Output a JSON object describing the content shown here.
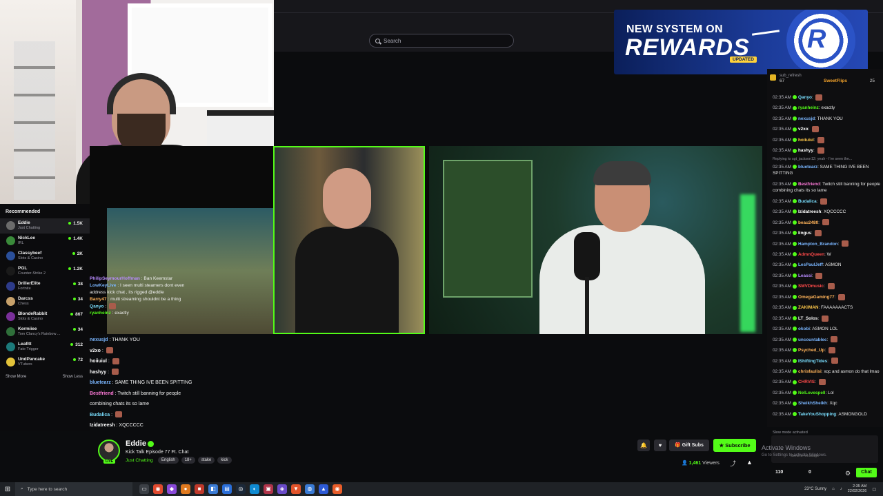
{
  "header": {
    "search_placeholder": "Search"
  },
  "rewards_banner": {
    "line1": "NEW SYSTEM ON",
    "line2": "REWARDS",
    "badge": "UPDATED",
    "chip_letter": "R"
  },
  "recommended": {
    "title": "Recommended",
    "items": [
      {
        "name": "Eddie",
        "category": "Just Chatting",
        "viewers": "1.5K",
        "color": "#6b6b6b"
      },
      {
        "name": "NickLee",
        "category": "IRL",
        "viewers": "1.4K",
        "color": "#3a8a3a"
      },
      {
        "name": "Classybeef",
        "category": "Slots & Casino",
        "viewers": "2K",
        "color": "#2a4f9a"
      },
      {
        "name": "PGL",
        "category": "Counter-Strike 2",
        "viewers": "1.2K",
        "color": "#1a1a1a"
      },
      {
        "name": "DrillerElite",
        "category": "Fortnite",
        "viewers": "38",
        "color": "#2d3b8a"
      },
      {
        "name": "Darcss",
        "category": "Chess",
        "viewers": "34",
        "color": "#c7a16b"
      },
      {
        "name": "BlondeRabbit",
        "category": "Slots & Casino",
        "viewers": "867",
        "color": "#7a2f9a"
      },
      {
        "name": "Kermiiee",
        "category": "Tom Clancy's Rainbow ...",
        "viewers": "34",
        "color": "#2f6f3a"
      },
      {
        "name": "Leafitt",
        "category": "Fate Trigger",
        "viewers": "312",
        "color": "#1c7a7a"
      },
      {
        "name": "UndPancake",
        "category": "VTubers",
        "viewers": "72",
        "color": "#e3c33a"
      }
    ],
    "show_more": "Show More",
    "show_less": "Show Less"
  },
  "overlay_chat_top": [
    {
      "user": "PhilipSeymourHoffman",
      "text": "Ban Keemstar",
      "color": "#b98cff"
    },
    {
      "user": "LowKeyLive",
      "text": "I seen multi steamers dont even",
      "color": "#7ab6ff"
    },
    {
      "user": "",
      "text": "address kick chat , its rigged @eddie",
      "color": "#ffffff"
    },
    {
      "user": "Barry47",
      "text": "multi streaming shouldnt be a thing",
      "color": "#ffb35a"
    },
    {
      "user": "Qanyo",
      "text": "",
      "color": "#7adfff"
    },
    {
      "user": "ryanheinz",
      "text": "exactly",
      "color": "#53fc18"
    }
  ],
  "overlay_chat_bottom": [
    {
      "user": "nexusjd",
      "text": "THANK YOU",
      "color": "#7ab6ff"
    },
    {
      "user": "v2xo",
      "text": "",
      "color": "#ffffff"
    },
    {
      "user": "hoiiuiul",
      "text": "",
      "color": "#ffffff"
    },
    {
      "user": "hashyy",
      "text": "",
      "color": "#ffffff"
    },
    {
      "user": "bluetearz",
      "text": "SAME THING IVE BEEN SPITTING",
      "color": "#7ab6ff"
    },
    {
      "user": "Bestfriend",
      "text": "Twitch still banning for people",
      "color": "#ff7ad9"
    },
    {
      "user": "",
      "text": "combining chats its so lame",
      "color": "#ffffff"
    },
    {
      "user": "Budalica",
      "text": "",
      "color": "#7adfff"
    },
    {
      "user": "Izidatreesh",
      "text": "XQCCCCC",
      "color": "#ffffff"
    }
  ],
  "chat_header": {
    "lead": "sub_refresh",
    "sweetflips": "SweetFlips",
    "left_count": "67",
    "right_count": "25"
  },
  "chat_messages": [
    {
      "time": "02:35 AM",
      "user": "Qanyo",
      "text": "",
      "color": "#7adfff"
    },
    {
      "time": "02:35 AM",
      "user": "ryanheinz",
      "text": "exactly",
      "color": "#53fc18"
    },
    {
      "time": "02:35 AM",
      "user": "nexusjd",
      "text": "THANK YOU",
      "color": "#7ab6ff"
    },
    {
      "time": "02:35 AM",
      "user": "v2xo",
      "text": "",
      "color": "#ffffff"
    },
    {
      "time": "02:35 AM",
      "user": "hoiiuiul",
      "text": "",
      "color": "#ffc84a"
    },
    {
      "time": "02:35 AM",
      "user": "hashyy",
      "text": "",
      "color": "#ffffff"
    },
    {
      "reply": "Replying to sgt_jackson12: yeah - I've seen the..."
    },
    {
      "time": "02:35 AM",
      "user": "bluetearz",
      "text": "SAME THING IVE BEEN SPITTING",
      "color": "#7ab6ff",
      "wrap": true
    },
    {
      "time": "02:35 AM",
      "user": "Bestfriend",
      "text": "Twitch still banning for people combining chats its so lame",
      "color": "#ff7ad9",
      "wrap": true
    },
    {
      "time": "02:35 AM",
      "user": "Budalica",
      "text": "",
      "color": "#7adfff"
    },
    {
      "time": "02:35 AM",
      "user": "Izidatreesh",
      "text": "XQCCCCC",
      "color": "#ffffff"
    },
    {
      "time": "02:35 AM",
      "user": "beau2480",
      "text": "",
      "color": "#ffb35a"
    },
    {
      "time": "02:35 AM",
      "user": "lingus",
      "text": "",
      "color": "#ffffff"
    },
    {
      "time": "02:35 AM",
      "user": "Hampton_Brandon",
      "text": "",
      "color": "#7ab6ff"
    },
    {
      "time": "02:35 AM",
      "user": "AdmnQueen",
      "text": "W",
      "color": "#ff4a4a"
    },
    {
      "time": "02:35 AM",
      "user": "LesPaulJeff",
      "text": "ASMON",
      "color": "#7ab6ff"
    },
    {
      "time": "02:35 AM",
      "user": "Leassi",
      "text": "",
      "color": "#b98cff"
    },
    {
      "time": "02:35 AM",
      "user": "SMVDmusic",
      "text": "",
      "color": "#ff4a4a"
    },
    {
      "time": "02:35 AM",
      "user": "OmegaGaming77",
      "text": "",
      "color": "#ffb35a"
    },
    {
      "time": "02:35 AM",
      "user": "ZAKIMAN",
      "text": "FAAAAAAACTS",
      "color": "#ffc84a"
    },
    {
      "time": "02:35 AM",
      "user": "LT_Solos",
      "text": "",
      "color": "#ffffff"
    },
    {
      "time": "02:35 AM",
      "user": "okobi",
      "text": "ASMON LOL",
      "color": "#7ab6ff"
    },
    {
      "time": "02:35 AM",
      "user": "uncountablec",
      "text": "",
      "color": "#7ab6ff"
    },
    {
      "time": "02:35 AM",
      "user": "Psyched_Up",
      "text": "",
      "color": "#ffb35a"
    },
    {
      "time": "02:35 AM",
      "user": "IShiftingTides",
      "text": "",
      "color": "#7adfff"
    },
    {
      "time": "02:35 AM",
      "user": "chrisfaulisi",
      "text": "xqc and asmon do that lmao",
      "color": "#ffb35a",
      "wrap": true
    },
    {
      "time": "02:35 AM",
      "user": "CHRVIS",
      "text": "",
      "color": "#ff4a4a"
    },
    {
      "time": "02:35 AM",
      "user": "NelLovespell",
      "text": "Lol",
      "color": "#53fc18"
    },
    {
      "time": "02:35 AM",
      "user": "SheikhSheikh",
      "text": "Xqc",
      "color": "#7ab6ff"
    },
    {
      "time": "02:35 AM",
      "user": "TakeYouShopping",
      "text": "ASMONGOLD",
      "color": "#7adfff"
    }
  ],
  "chat_footer": {
    "slow_mode": "Slow mode activated",
    "send_placeholder": "Send a message",
    "points": "110",
    "points2": "0",
    "chat_button": "Chat"
  },
  "windows_watermark": {
    "line1": "Activate Windows",
    "line2": "Go to Settings to activate Windows."
  },
  "stream": {
    "streamer": "Eddie",
    "live_badge": "LIVE",
    "title": "Kick Talk Episode 77 Ft. Chat",
    "category": "Just Chatting",
    "tags": [
      "English",
      "18+",
      "stake",
      "kick"
    ],
    "gift_subs": "Gift Subs",
    "subscribe": "Subscribe",
    "viewers_count": "1,461",
    "viewers_label": "Viewers"
  },
  "taskbar": {
    "search_placeholder": "Type here to search",
    "weather": "23°C  Sunny",
    "time": "2:35 AM",
    "date": "22/02/2026"
  },
  "colors": {
    "accent": "#53fc18",
    "banner": "#1c3c9a"
  }
}
